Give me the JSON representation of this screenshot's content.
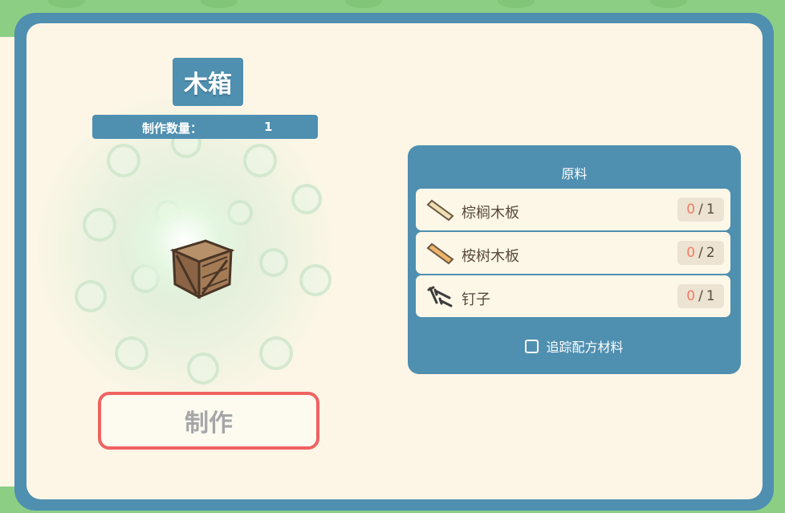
{
  "item": {
    "title": "木箱",
    "quantity_label": "制作数量：",
    "quantity_value": "1",
    "icon": "wooden-crate-icon"
  },
  "actions": {
    "make_label": "制作"
  },
  "materials": {
    "title": "原料",
    "items": [
      {
        "name": "棕榈木板",
        "have": "0",
        "sep": "/",
        "need": "1",
        "icon": "palm-plank-icon"
      },
      {
        "name": "桉树木板",
        "have": "0",
        "sep": "/",
        "need": "2",
        "icon": "eucalyptus-plank-icon"
      },
      {
        "name": "钉子",
        "have": "0",
        "sep": "/",
        "need": "1",
        "icon": "nails-icon"
      }
    ],
    "track_label": "追踪配方材料"
  },
  "colors": {
    "accent_blue": "#4f8fb0",
    "panel_cream": "#fdf6e6",
    "button_border": "#ef6262",
    "count_have": "#ef7d62",
    "background_green": "#8ccf84"
  }
}
